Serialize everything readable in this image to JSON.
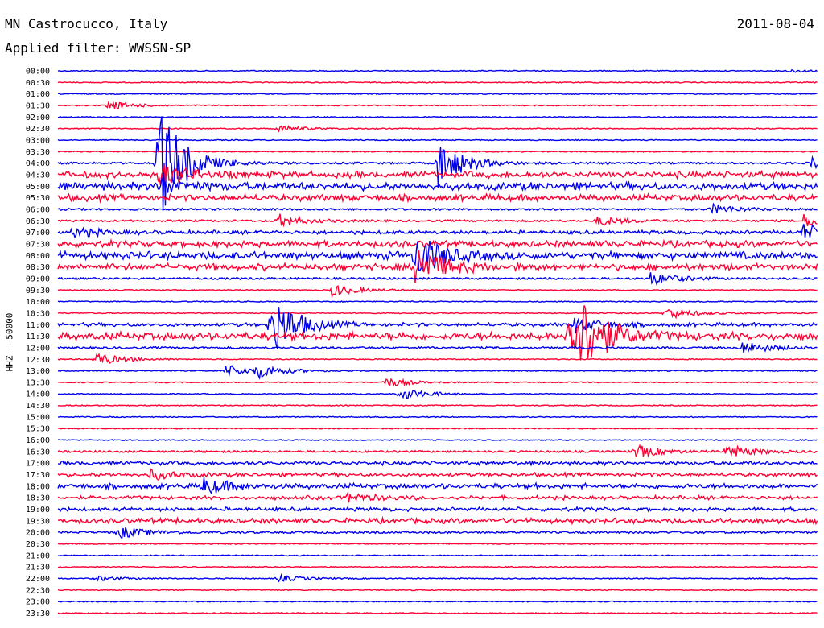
{
  "header": {
    "station": "MN Castrocucco, Italy",
    "date": "2011-08-04",
    "filter_label": "Applied filter: WWSSN-SP"
  },
  "chart_data": {
    "type": "line",
    "title": "MN Castrocucco, Italy",
    "subtitle": "Applied filter: WWSSN-SP",
    "date": "2011-08-04",
    "ylabel": "HHZ - 50000",
    "xlabel": "",
    "row_interval_minutes": 30,
    "colors": {
      "even_row": "#0000ee",
      "odd_row": "#ff0033"
    },
    "row_labels": [
      "00:00",
      "00:30",
      "01:00",
      "01:30",
      "02:00",
      "02:30",
      "03:00",
      "03:30",
      "04:00",
      "04:30",
      "05:00",
      "05:30",
      "06:00",
      "06:30",
      "07:00",
      "07:30",
      "08:00",
      "08:30",
      "09:00",
      "09:30",
      "10:00",
      "10:30",
      "11:00",
      "11:30",
      "12:00",
      "12:30",
      "13:00",
      "13:30",
      "14:00",
      "14:30",
      "15:00",
      "15:30",
      "16:00",
      "16:30",
      "17:00",
      "17:30",
      "18:00",
      "18:30",
      "19:00",
      "19:30",
      "20:00",
      "20:30",
      "21:00",
      "21:30",
      "22:00",
      "22:30",
      "23:00",
      "23:30"
    ],
    "noise_level": [
      1,
      1,
      1,
      1,
      1,
      1,
      1,
      1,
      2,
      5,
      6,
      5,
      2,
      2,
      3,
      5,
      6,
      5,
      2,
      1,
      1,
      1,
      3,
      6,
      2,
      1,
      1,
      1,
      1,
      1,
      1,
      1,
      1,
      2,
      3,
      3,
      4,
      3,
      3,
      4,
      2,
      1,
      1,
      1,
      1,
      1,
      1,
      1
    ],
    "events": [
      {
        "row": 0,
        "t": 0.96,
        "amp": 2
      },
      {
        "row": 3,
        "t": 0.065,
        "amp": 6
      },
      {
        "row": 5,
        "t": 0.29,
        "amp": 4
      },
      {
        "row": 8,
        "t": 0.135,
        "amp": 45
      },
      {
        "row": 8,
        "t": 0.13,
        "amp": 28
      },
      {
        "row": 8,
        "t": 0.5,
        "amp": 30
      },
      {
        "row": 8,
        "t": 0.99,
        "amp": 8
      },
      {
        "row": 9,
        "t": 0.135,
        "amp": 15
      },
      {
        "row": 10,
        "t": 0.135,
        "amp": 10
      },
      {
        "row": 12,
        "t": 0.86,
        "amp": 6
      },
      {
        "row": 13,
        "t": 0.29,
        "amp": 8
      },
      {
        "row": 13,
        "t": 0.71,
        "amp": 6
      },
      {
        "row": 13,
        "t": 0.98,
        "amp": 8
      },
      {
        "row": 14,
        "t": 0.02,
        "amp": 6
      },
      {
        "row": 14,
        "t": 0.98,
        "amp": 10
      },
      {
        "row": 16,
        "t": 0.47,
        "amp": 30
      },
      {
        "row": 17,
        "t": 0.47,
        "amp": 30
      },
      {
        "row": 18,
        "t": 0.78,
        "amp": 8
      },
      {
        "row": 19,
        "t": 0.36,
        "amp": 8
      },
      {
        "row": 21,
        "t": 0.8,
        "amp": 8
      },
      {
        "row": 22,
        "t": 0.28,
        "amp": 40
      },
      {
        "row": 22,
        "t": 0.68,
        "amp": 10
      },
      {
        "row": 23,
        "t": 0.67,
        "amp": 42
      },
      {
        "row": 23,
        "t": 0.69,
        "amp": 30
      },
      {
        "row": 24,
        "t": 0.9,
        "amp": 8
      },
      {
        "row": 25,
        "t": 0.05,
        "amp": 8
      },
      {
        "row": 26,
        "t": 0.22,
        "amp": 8
      },
      {
        "row": 26,
        "t": 0.26,
        "amp": 8
      },
      {
        "row": 27,
        "t": 0.43,
        "amp": 6
      },
      {
        "row": 28,
        "t": 0.45,
        "amp": 8
      },
      {
        "row": 33,
        "t": 0.76,
        "amp": 8
      },
      {
        "row": 33,
        "t": 0.88,
        "amp": 8
      },
      {
        "row": 35,
        "t": 0.12,
        "amp": 6
      },
      {
        "row": 36,
        "t": 0.19,
        "amp": 10
      },
      {
        "row": 37,
        "t": 0.38,
        "amp": 6
      },
      {
        "row": 40,
        "t": 0.08,
        "amp": 8
      },
      {
        "row": 44,
        "t": 0.29,
        "amp": 4
      },
      {
        "row": 44,
        "t": 0.05,
        "amp": 3
      }
    ]
  }
}
